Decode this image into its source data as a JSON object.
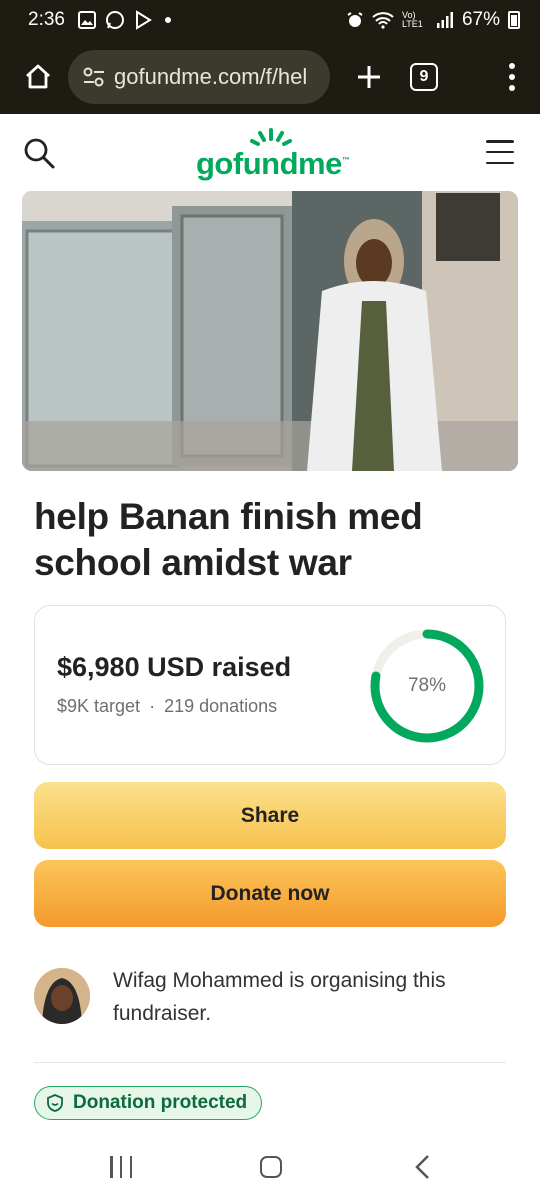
{
  "status_bar": {
    "time": "2:36",
    "lte_label": "Vo) LTE1",
    "battery": "67%"
  },
  "browser": {
    "url": "gofundme.com/f/hel",
    "tab_count": "9"
  },
  "site": {
    "logo_text": "gofundme",
    "logo_tm": "™"
  },
  "campaign": {
    "title": "help Banan finish med school amidst war",
    "raised": "$6,980 USD raised",
    "target": "$9K target",
    "separator": "·",
    "donations": "219 donations",
    "progress_label": "78%",
    "progress": 0.78
  },
  "buttons": {
    "share": "Share",
    "donate": "Donate now"
  },
  "organiser": {
    "text": "Wifag Mohammed is organising this fundraiser."
  },
  "badge": {
    "label": "Donation protected"
  },
  "colors": {
    "brand_green": "#02a95c",
    "share": "#f6c24d",
    "donate": "#f49a2b",
    "status_bg": "#1e1c12"
  },
  "icons": [
    "home-icon",
    "tune-icon",
    "plus-icon",
    "tabs-icon",
    "more-icon",
    "search-icon",
    "hamburger-icon",
    "shield-icon"
  ]
}
